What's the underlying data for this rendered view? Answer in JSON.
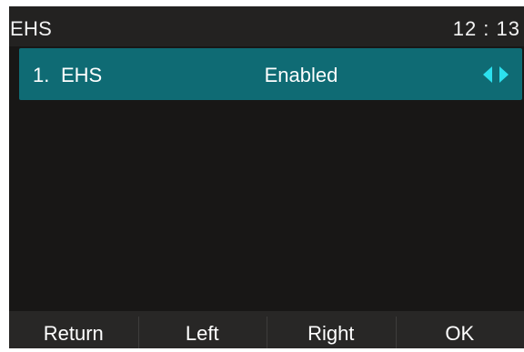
{
  "status_bar": {
    "title": "EHS",
    "time": "12 : 13"
  },
  "list": {
    "items": [
      {
        "index": "1.",
        "label": "EHS",
        "value": "Enabled",
        "selected": true,
        "icons": [
          "arrow-left-icon",
          "arrow-right-icon"
        ]
      }
    ]
  },
  "softkeys": {
    "return_label": "Return",
    "left_label": "Left",
    "right_label": "Right",
    "ok_label": "OK"
  },
  "colors": {
    "screen_background": "#181716",
    "title_bar": "#232221",
    "selected_row": "#0f6b74",
    "arrow_accent": "#2ce0ee",
    "softkey_bar": "#282726",
    "text": "#ffffff"
  }
}
